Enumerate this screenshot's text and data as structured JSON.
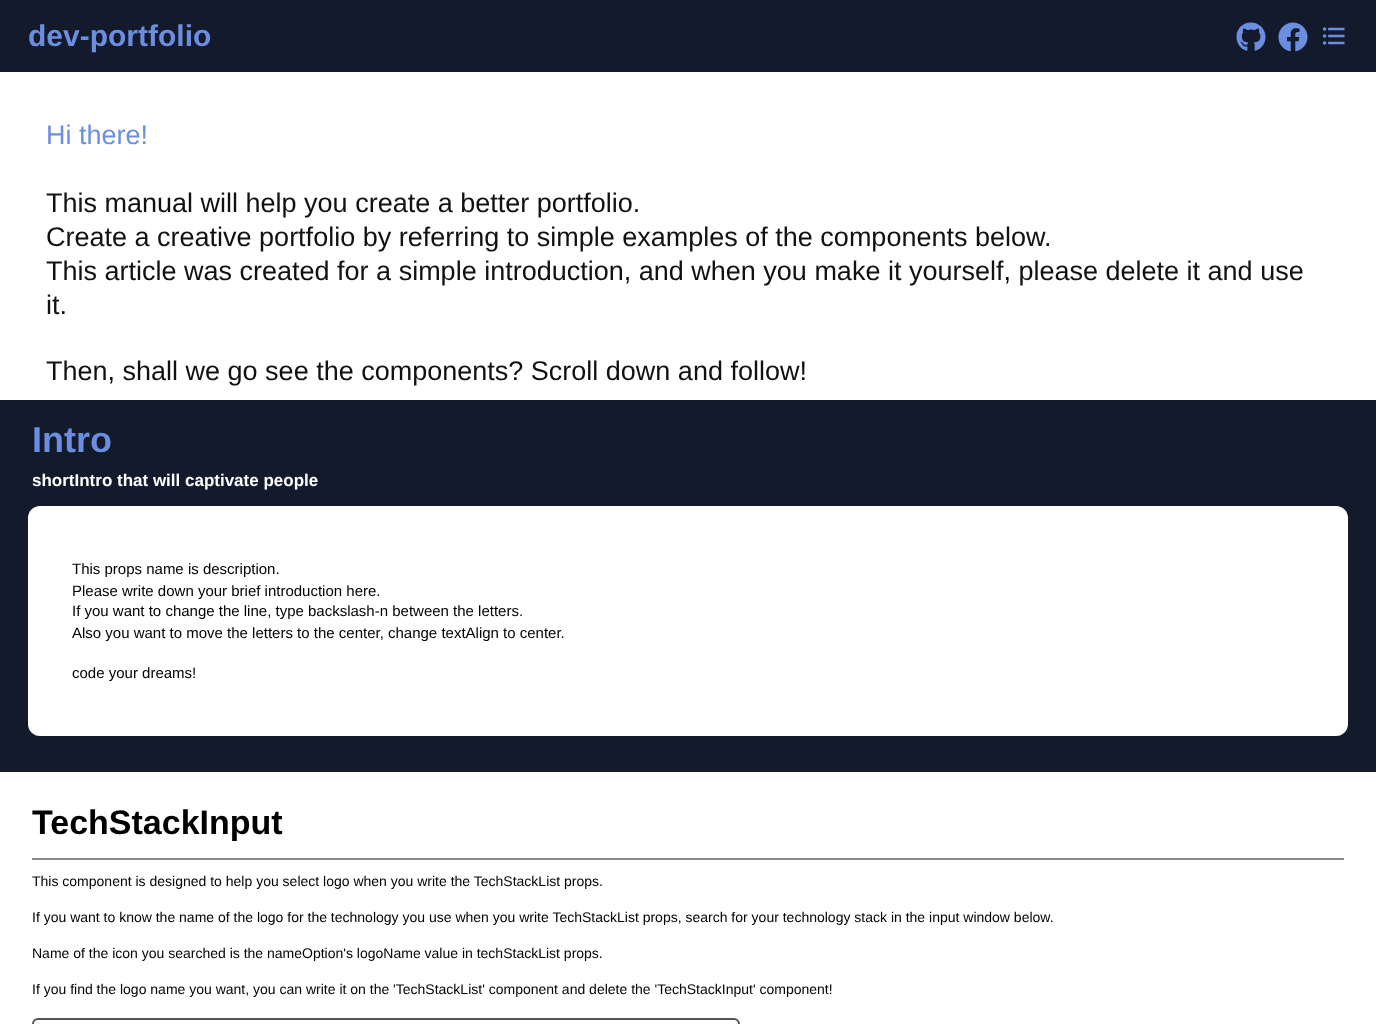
{
  "header": {
    "title": "dev-portfolio"
  },
  "welcome": {
    "greeting": "Hi there!",
    "paragraphs": [
      "This manual will help you create a better portfolio.\nCreate a creative portfolio by referring to simple examples of the components below.\nThis article was created for a simple introduction, and when you make it yourself, please delete it and use it.",
      "Then, shall we go see the components? Scroll down and follow!"
    ]
  },
  "intro": {
    "title": "Intro",
    "short_intro": "shortIntro that will captivate people",
    "description": [
      "This props name is description.\nPlease write down your brief introduction here.\nIf you want to change the line, type backslash-n between the letters.\nAlso you want to move the letters to the center, change textAlign to center.",
      "code your dreams!"
    ]
  },
  "tech_stack_input": {
    "title": "TechStackInput",
    "paragraphs": [
      "This component is designed to help you select logo when you write the TechStackList props.",
      "If you want to know the name of the logo for the technology you use when you write TechStackList props, search for your technology stack in the input window below.",
      "Name of the icon you searched is the nameOption's logoName value in techStackList props.",
      "If you find the logo name you want, you can write it on the 'TechStackList' component and delete the 'TechStackInput' component!"
    ]
  }
}
